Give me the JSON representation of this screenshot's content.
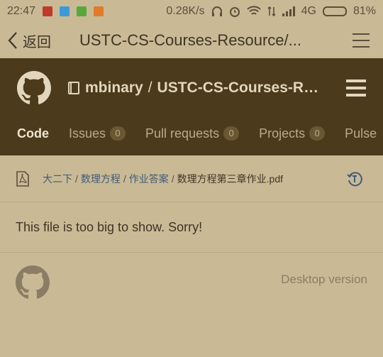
{
  "status_bar": {
    "time": "22:47",
    "network_speed": "0.28K/s",
    "network_type": "4G",
    "battery_percent_label": "81%",
    "battery_level": 0.81,
    "app_icon_colors": [
      "#c0392b",
      "#3a9ad9",
      "#58a83b",
      "#e27b2a"
    ]
  },
  "title_bar": {
    "back_label": "返回",
    "title": "USTC-CS-Courses-Resource/..."
  },
  "repo_header": {
    "owner": "mbinary",
    "separator": "/",
    "repo_name": "USTC-CS-Courses-Res..."
  },
  "tabs": [
    {
      "label": "Code",
      "count": null,
      "active": true
    },
    {
      "label": "Issues",
      "count": "0",
      "active": false
    },
    {
      "label": "Pull requests",
      "count": "0",
      "active": false
    },
    {
      "label": "Projects",
      "count": "0",
      "active": false
    },
    {
      "label": "Pulse",
      "count": null,
      "active": false
    }
  ],
  "breadcrumb": {
    "parts": [
      "大二下",
      "数理方程",
      "作业答案"
    ],
    "separator": "/",
    "file": "数理方程第三章作业.pdf"
  },
  "message": "This file is too big to show. Sorry!",
  "footer": {
    "desktop_version_label": "Desktop version"
  },
  "colors": {
    "header_bg": "#4b3a1c",
    "page_bg": "#c9b995",
    "link": "#3e5c7a"
  }
}
